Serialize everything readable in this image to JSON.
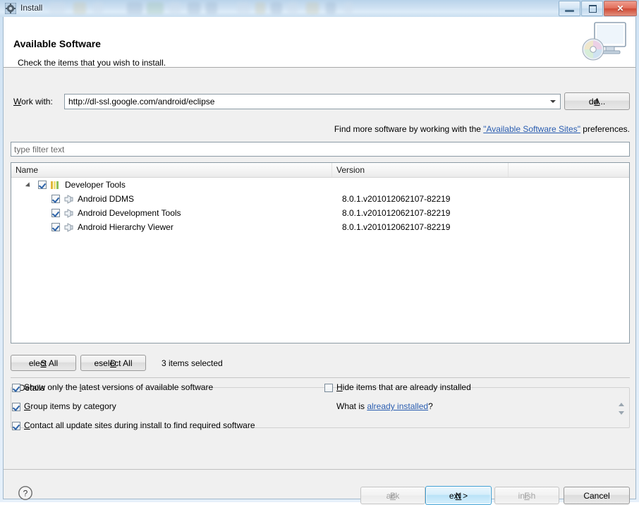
{
  "window": {
    "title": "Install",
    "app_icon": "install-gear-icon",
    "controls": {
      "minimize": "–",
      "maximize": "□",
      "close": "✕"
    }
  },
  "banner": {
    "title": "Available Software",
    "subtitle": "Check the items that you wish to install.",
    "icon": "monitor-disc-icon"
  },
  "work_with": {
    "label": "Work with:",
    "label_prefix": "W",
    "label_rest": "ork with:",
    "value": "http://dl-ssl.google.com/android/eclipse",
    "placeholder": "",
    "add_button": "Add...",
    "add_mnemonic": "A",
    "add_rest": "dd..."
  },
  "hint": {
    "before": "Find more software by working with the ",
    "link": "\"Available Software Sites\"",
    "after": " preferences."
  },
  "filter": {
    "placeholder": "type filter text",
    "value": ""
  },
  "table": {
    "columns": [
      "Name",
      "Version",
      ""
    ],
    "rows": [
      {
        "name": "Developer Tools",
        "version": "",
        "checked": true,
        "level": 0,
        "expanded": true,
        "icon": "category-icon"
      },
      {
        "name": "Android DDMS",
        "version": "8.0.1.v201012062107-82219",
        "checked": true,
        "level": 1,
        "icon": "feature-plugin-icon"
      },
      {
        "name": "Android Development Tools",
        "version": "8.0.1.v201012062107-82219",
        "checked": true,
        "level": 1,
        "icon": "feature-plugin-icon"
      },
      {
        "name": "Android Hierarchy Viewer",
        "version": "8.0.1.v201012062107-82219",
        "checked": true,
        "level": 1,
        "icon": "feature-plugin-icon"
      }
    ]
  },
  "selection": {
    "select_all": "Select All",
    "select_all_mnemonic": "S",
    "select_all_rest": "elect All",
    "deselect_all": "Deselect All",
    "deselect_all_mnemonic": "D",
    "deselect_all_rest": "eselect All",
    "status": "3 items selected"
  },
  "details": {
    "title": "Details",
    "content": ""
  },
  "options": {
    "show_latest": {
      "checked": true,
      "pre": "Show only the ",
      "mnemonic": "l",
      "post": "atest versions of available software"
    },
    "group_by_category": {
      "checked": true,
      "pre": "",
      "mnemonic": "G",
      "post": "roup items by category"
    },
    "contact_all_sites": {
      "checked": true,
      "pre": "",
      "mnemonic": "C",
      "post": "ontact all update sites during install to find required software"
    },
    "hide_installed": {
      "checked": false,
      "pre": "",
      "mnemonic": "H",
      "post": "ide items that are already installed"
    },
    "what_is_installed": {
      "before": "What is ",
      "link": "already installed",
      "after": "?"
    }
  },
  "footer": {
    "help": "?",
    "back": {
      "pre": "< ",
      "mnemonic": "B",
      "post": "ack",
      "enabled": false
    },
    "next": {
      "pre": "",
      "mnemonic": "N",
      "post": "ext >",
      "enabled": true,
      "default": true
    },
    "finish": {
      "pre": "",
      "mnemonic": "F",
      "post": "inish",
      "enabled": false
    },
    "cancel": {
      "pre": "",
      "mnemonic": "",
      "post": "Cancel",
      "enabled": true
    }
  },
  "colors": {
    "accent": "#3c9fd4",
    "link": "#2a5db0",
    "window_bg": "#f0f0f0",
    "close_button": "#cf4b36"
  }
}
